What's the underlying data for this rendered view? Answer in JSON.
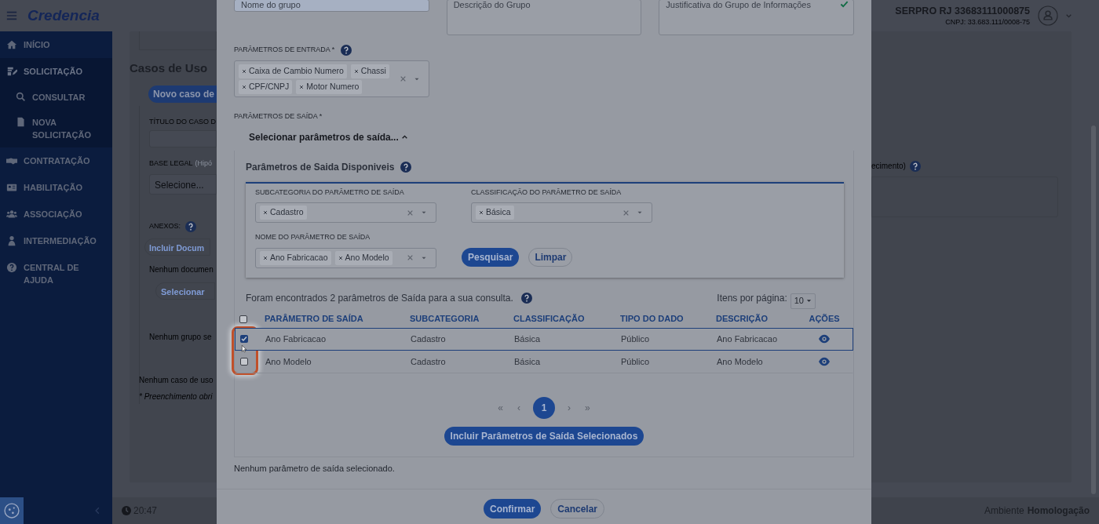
{
  "header": {
    "logo": "Credencia",
    "user_name": "SERPRO RJ 33683111000875",
    "user_cnpj": "CNPJ: 33.683.111/0008-75"
  },
  "sidebar": {
    "items": [
      {
        "label": "INÍCIO",
        "expanded": false
      },
      {
        "label": "SOLICITAÇÃO",
        "expanded": true,
        "children": [
          {
            "label": "CONSULTAR"
          },
          {
            "label": "NOVA SOLICITAÇÃO"
          }
        ]
      },
      {
        "label": "CONTRATAÇÃO",
        "expanded": false
      },
      {
        "label": "HABILITAÇÃO",
        "expanded": false
      },
      {
        "label": "ASSOCIAÇÃO",
        "expanded": false
      },
      {
        "label": "INTERMEDIAÇÃO",
        "expanded": false
      },
      {
        "label": "CENTRAL DE AJUDA",
        "expanded": false
      }
    ]
  },
  "footer": {
    "time": "20:47",
    "environment_label": "Ambiente",
    "environment": "Homologação"
  },
  "background_page": {
    "section_title": "Casos de Uso",
    "new_button": "Novo caso de",
    "title_label": "TÍTULO DO CASO D",
    "base_legal_label": "BASE LEGAL",
    "base_legal_hint": "(Hipó",
    "base_legal_placeholder": "Selecione...",
    "right_hint": "ecimento)",
    "attachments_label": "ANEXOS:",
    "include_button": "Incluir Docum",
    "no_documents": "Nenhum documen",
    "select_button": "Selecionar",
    "no_group": "Nenhum grupo se",
    "no_use_case": "Nenhum caso de uso",
    "required_note": "* Preenchimento obri"
  },
  "modal": {
    "top_fields": [
      {
        "placeholder": "Nome do grupo",
        "valid": false
      },
      {
        "placeholder": "Descrição do Grupo",
        "valid": false
      },
      {
        "placeholder": "Justificativa do Grupo de Informações",
        "valid": true
      }
    ],
    "input_params": {
      "label": "PARÂMETROS DE ENTRADA *",
      "tags": [
        "Caixa de Cambio Numero",
        "Chassi",
        "CPF/CNPJ",
        "Motor Numero"
      ]
    },
    "output_params": {
      "label": "PARÂMETROS DE SAÍDA *",
      "toggle": "Selecionar parâmetros de saída...",
      "expanded": true,
      "panel_title": "Parâmetros de Saida Disponiveis",
      "filters": [
        {
          "label": "SUBCATEGORIA DO PARÂMETRO DE SAÍDA",
          "tags": [
            "Cadastro"
          ]
        },
        {
          "label": "CLASSIFICAÇÃO DO PARÂMETRO DE SAÍDA",
          "tags": [
            "Básica"
          ]
        },
        {
          "label": "NOME DO PARÂMETRO DE SAÍDA",
          "tags": [
            "Ano Fabricacao",
            "Ano Modelo"
          ]
        }
      ],
      "search_button": "Pesquisar",
      "clear_button": "Limpar",
      "result_text": "Foram encontrados 2 parâmetros de Saída para a sua consulta.",
      "per_page_label": "Itens por página:",
      "per_page": "10",
      "table": {
        "select_all_checked": false,
        "columns": [
          "PARÂMETRO DE SAÍDA",
          "SUBCATEGORIA",
          "CLASSIFICAÇÃO",
          "TIPO DO DADO",
          "DESCRIÇÃO",
          "AÇÕES"
        ],
        "rows": [
          {
            "checked": true,
            "selected": true,
            "cells": [
              "Ano Fabricacao",
              "Cadastro",
              "Básica",
              "Público",
              "Ano Fabricacao"
            ]
          },
          {
            "checked": false,
            "selected": false,
            "cells": [
              "Ano Modelo",
              "Cadastro",
              "Básica",
              "Público",
              "Ano Modelo"
            ]
          }
        ]
      },
      "pagination": {
        "first": "«",
        "prev": "‹",
        "pages": [
          {
            "label": "1",
            "selected": true
          }
        ],
        "next": "›",
        "last": "»"
      },
      "include_button": "Incluir Parâmetros de Saída Selecionados",
      "empty_note": "Nenhum parâmetro de saída selecionado."
    },
    "confirm_button": "Confirmar",
    "cancel_button": "Cancelar"
  }
}
